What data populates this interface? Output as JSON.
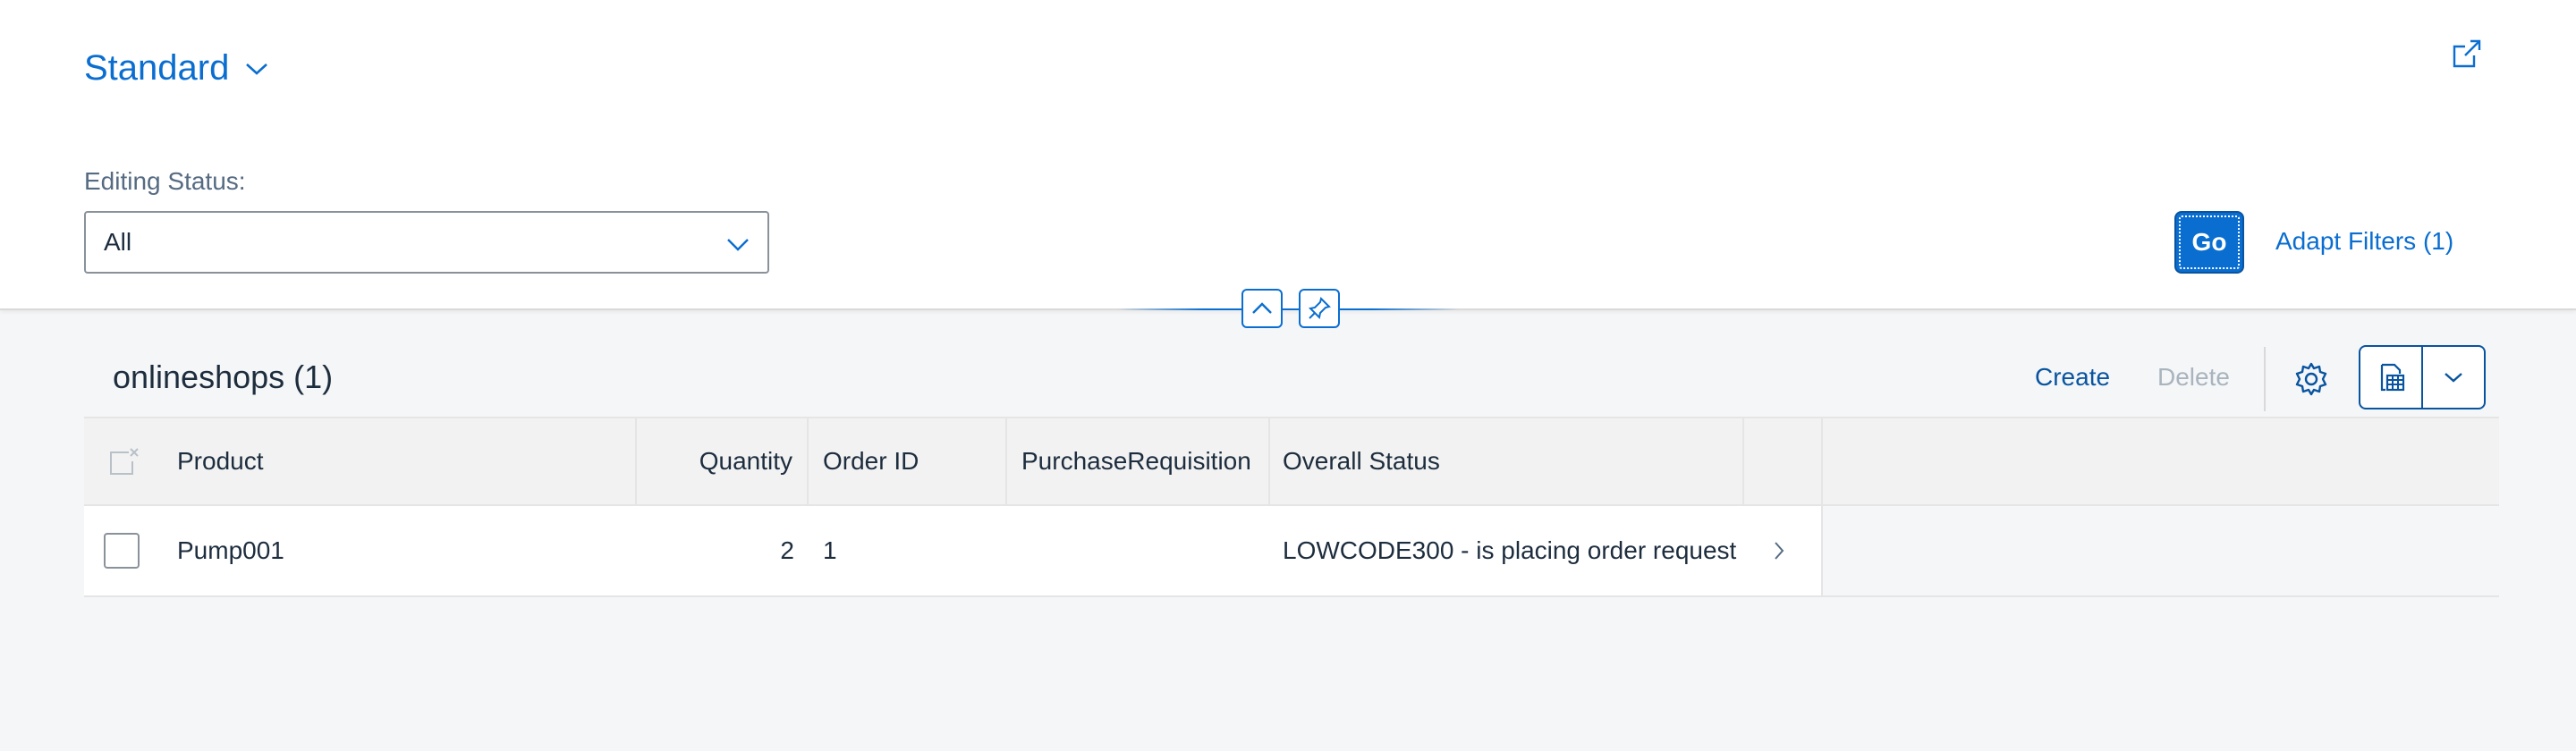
{
  "variant": {
    "title": "Standard",
    "icon": "chevron-down-icon"
  },
  "share": {
    "icon": "share-icon"
  },
  "filter": {
    "label": "Editing Status:",
    "value": "All"
  },
  "filterbar": {
    "go_label": "Go",
    "adapt_label": "Adapt Filters (1)"
  },
  "table": {
    "title": "onlineshops (1)",
    "create_label": "Create",
    "delete_label": "Delete",
    "columns": [
      "Product",
      "Quantity",
      "Order ID",
      "PurchaseRequisition",
      "Overall Status"
    ],
    "rows": [
      {
        "product": "Pump001",
        "quantity": "2",
        "order_id": "1",
        "purchase_requisition": "",
        "overall_status": "LOWCODE300 - is placing order request"
      }
    ]
  },
  "colors": {
    "accent": "#0a6ed1",
    "text": "#1d2d3e",
    "muted": "#556b82",
    "disabled": "#a9b4be"
  }
}
